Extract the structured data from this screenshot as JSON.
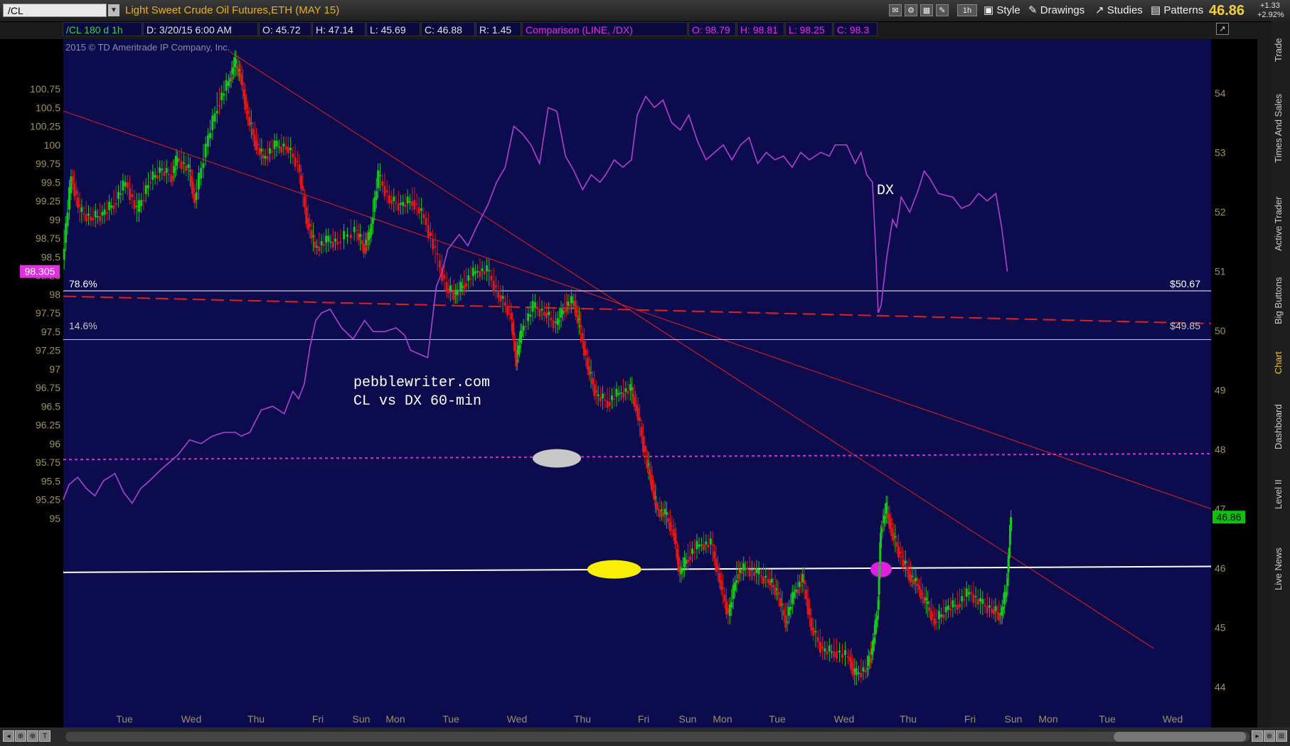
{
  "toolbar": {
    "symbol": "/CL",
    "instrument": "Light Sweet Crude Oil Futures,ETH (MAY 15)",
    "timeframe": "1h",
    "style_label": "Style",
    "drawings_label": "Drawings",
    "studies_label": "Studies",
    "patterns_label": "Patterns",
    "last_price": "46.86",
    "change_abs": "+1.33",
    "change_pct": "+2.92%"
  },
  "infobar": {
    "symbol_period": "/CL 180 d 1h",
    "date": "D: 3/20/15 6:00 AM",
    "open": "O: 45.72",
    "high": "H: 47.14",
    "low": "L: 45.69",
    "close": "C: 46.88",
    "range": "R: 1.45",
    "comparison": "Comparison (LINE, /DX)",
    "cmp_open": "O: 98.79",
    "cmp_high": "H: 98.81",
    "cmp_low": "L: 98.25",
    "cmp_close": "C: 98.3"
  },
  "side_tabs": [
    "Trade",
    "Times And Sales",
    "Active Trader",
    "Big Buttons",
    "Chart",
    "Dashboard",
    "Level II",
    "Live News"
  ],
  "colors": {
    "background": "#0c0b4e",
    "candle_up": "#18c818",
    "candle_down": "#e01818",
    "dx_line": "#b040d0",
    "trendline": "#e02020",
    "dotted_level": "#d030d0",
    "axis_text": "#a09060",
    "title_orange": "#e8b020"
  },
  "chart_data": {
    "type": "candlestick-with-comparison-line",
    "copyright": "2015 © TD Ameritrade IP Company, Inc.",
    "annotations": {
      "site": "pebblewriter.com",
      "subtitle": "CL vs DX 60-min",
      "dx_label": "DX",
      "fib_upper_pct": "78.6%",
      "fib_upper_price": "$50.67",
      "fib_lower_pct": "14.6%",
      "fib_lower_price": "$49.85"
    },
    "left_axis": {
      "label_series": "/DX",
      "range": [
        95.0,
        101.0
      ],
      "ticks": [
        "100.75",
        "100.5",
        "100.25",
        "100",
        "99.75",
        "99.5",
        "99.25",
        "99",
        "98.75",
        "98.5",
        "98.25",
        "98",
        "97.75",
        "97.5",
        "97.25",
        "97",
        "96.75",
        "96.5",
        "96.25",
        "96",
        "95.75",
        "95.5",
        "95.25",
        "95"
      ],
      "marker": "98.305"
    },
    "right_axis": {
      "label_series": "/CL",
      "range": [
        43.7,
        54.9
      ],
      "ticks": [
        "54",
        "53",
        "52",
        "51",
        "50",
        "49",
        "48",
        "47",
        "46",
        "45",
        "44"
      ],
      "marker": "46.86"
    },
    "x_labels": [
      "Tue",
      "Wed",
      "Thu",
      "Fri",
      "Sun",
      "Mon",
      "Tue",
      "Wed",
      "Thu",
      "Fri",
      "Sun",
      "Mon",
      "Tue",
      "Wed",
      "Thu",
      "Fri",
      "Sun",
      "Mon",
      "Tue",
      "Wed"
    ],
    "x_label_days": [
      1,
      2,
      3,
      4,
      5,
      6,
      7,
      8,
      9,
      10,
      11,
      12,
      13,
      14,
      15,
      16,
      17,
      18,
      19,
      20
    ],
    "x_range": [
      0.1,
      20.1
    ],
    "cl_series": [
      {
        "x": 0.1,
        "y": 51.2
      },
      {
        "x": 0.25,
        "y": 52.6
      },
      {
        "x": 0.4,
        "y": 52.0
      },
      {
        "x": 0.6,
        "y": 51.9
      },
      {
        "x": 0.8,
        "y": 51.95
      },
      {
        "x": 1.0,
        "y": 52.15
      },
      {
        "x": 1.2,
        "y": 52.5
      },
      {
        "x": 1.4,
        "y": 52.0
      },
      {
        "x": 1.6,
        "y": 52.5
      },
      {
        "x": 1.8,
        "y": 52.7
      },
      {
        "x": 2.0,
        "y": 52.6
      },
      {
        "x": 2.1,
        "y": 52.9
      },
      {
        "x": 2.3,
        "y": 52.7
      },
      {
        "x": 2.4,
        "y": 52.2
      },
      {
        "x": 2.6,
        "y": 53.1
      },
      {
        "x": 2.8,
        "y": 53.8
      },
      {
        "x": 3.0,
        "y": 54.2
      },
      {
        "x": 3.1,
        "y": 54.5
      },
      {
        "x": 3.2,
        "y": 54.3
      },
      {
        "x": 3.3,
        "y": 53.7
      },
      {
        "x": 3.45,
        "y": 53.2
      },
      {
        "x": 3.6,
        "y": 52.9
      },
      {
        "x": 3.8,
        "y": 53.1
      },
      {
        "x": 4.0,
        "y": 53.1
      },
      {
        "x": 4.2,
        "y": 52.8
      },
      {
        "x": 4.35,
        "y": 51.9
      },
      {
        "x": 4.5,
        "y": 51.4
      },
      {
        "x": 4.7,
        "y": 51.5
      },
      {
        "x": 4.9,
        "y": 51.5
      },
      {
        "x": 5.2,
        "y": 51.7
      },
      {
        "x": 5.35,
        "y": 51.4
      },
      {
        "x": 5.45,
        "y": 51.6
      },
      {
        "x": 5.6,
        "y": 52.6
      },
      {
        "x": 5.8,
        "y": 52.2
      },
      {
        "x": 6.0,
        "y": 52.1
      },
      {
        "x": 6.2,
        "y": 52.2
      },
      {
        "x": 6.4,
        "y": 51.9
      },
      {
        "x": 6.6,
        "y": 51.3
      },
      {
        "x": 6.8,
        "y": 50.7
      },
      {
        "x": 6.95,
        "y": 50.6
      },
      {
        "x": 7.1,
        "y": 50.8
      },
      {
        "x": 7.3,
        "y": 51.0
      },
      {
        "x": 7.5,
        "y": 51.0
      },
      {
        "x": 7.7,
        "y": 50.6
      },
      {
        "x": 7.9,
        "y": 50.3
      },
      {
        "x": 8.0,
        "y": 49.5
      },
      {
        "x": 8.1,
        "y": 50.0
      },
      {
        "x": 8.3,
        "y": 50.4
      },
      {
        "x": 8.5,
        "y": 50.3
      },
      {
        "x": 8.7,
        "y": 50.1
      },
      {
        "x": 8.85,
        "y": 50.4
      },
      {
        "x": 9.0,
        "y": 50.5
      },
      {
        "x": 9.1,
        "y": 50.1
      },
      {
        "x": 9.25,
        "y": 49.4
      },
      {
        "x": 9.4,
        "y": 48.9
      },
      {
        "x": 9.6,
        "y": 48.8
      },
      {
        "x": 9.8,
        "y": 48.95
      },
      {
        "x": 10.0,
        "y": 49.0
      },
      {
        "x": 10.1,
        "y": 48.7
      },
      {
        "x": 10.25,
        "y": 47.9
      },
      {
        "x": 10.35,
        "y": 47.5
      },
      {
        "x": 10.45,
        "y": 47.0
      },
      {
        "x": 10.6,
        "y": 46.9
      },
      {
        "x": 10.75,
        "y": 46.6
      },
      {
        "x": 10.85,
        "y": 45.9
      },
      {
        "x": 11.0,
        "y": 46.2
      },
      {
        "x": 11.2,
        "y": 46.4
      },
      {
        "x": 11.4,
        "y": 46.4
      },
      {
        "x": 11.55,
        "y": 45.8
      },
      {
        "x": 11.7,
        "y": 45.2
      },
      {
        "x": 11.85,
        "y": 45.9
      },
      {
        "x": 12.0,
        "y": 46.0
      },
      {
        "x": 12.2,
        "y": 45.9
      },
      {
        "x": 12.4,
        "y": 45.8
      },
      {
        "x": 12.55,
        "y": 45.6
      },
      {
        "x": 12.7,
        "y": 45.1
      },
      {
        "x": 12.85,
        "y": 45.6
      },
      {
        "x": 13.0,
        "y": 45.8
      },
      {
        "x": 13.15,
        "y": 45.0
      },
      {
        "x": 13.35,
        "y": 44.6
      },
      {
        "x": 13.55,
        "y": 44.6
      },
      {
        "x": 13.8,
        "y": 44.5
      },
      {
        "x": 13.9,
        "y": 44.2
      },
      {
        "x": 14.1,
        "y": 44.3
      },
      {
        "x": 14.2,
        "y": 44.6
      },
      {
        "x": 14.3,
        "y": 45.3
      },
      {
        "x": 14.35,
        "y": 46.6
      },
      {
        "x": 14.45,
        "y": 47.0
      },
      {
        "x": 14.55,
        "y": 46.6
      },
      {
        "x": 14.7,
        "y": 46.2
      },
      {
        "x": 14.85,
        "y": 45.9
      },
      {
        "x": 15.0,
        "y": 45.7
      },
      {
        "x": 15.15,
        "y": 45.4
      },
      {
        "x": 15.3,
        "y": 45.1
      },
      {
        "x": 15.5,
        "y": 45.3
      },
      {
        "x": 15.7,
        "y": 45.4
      },
      {
        "x": 15.9,
        "y": 45.6
      },
      {
        "x": 16.1,
        "y": 45.4
      },
      {
        "x": 16.3,
        "y": 45.3
      },
      {
        "x": 16.45,
        "y": 45.2
      },
      {
        "x": 16.55,
        "y": 45.7
      },
      {
        "x": 16.62,
        "y": 46.86
      }
    ],
    "dx_series": [
      {
        "x": 0.1,
        "y": 95.25
      },
      {
        "x": 0.2,
        "y": 95.45
      },
      {
        "x": 0.35,
        "y": 95.55
      },
      {
        "x": 0.5,
        "y": 95.4
      },
      {
        "x": 0.65,
        "y": 95.3
      },
      {
        "x": 0.8,
        "y": 95.5
      },
      {
        "x": 1.0,
        "y": 95.6
      },
      {
        "x": 1.15,
        "y": 95.35
      },
      {
        "x": 1.3,
        "y": 95.2
      },
      {
        "x": 1.45,
        "y": 95.4
      },
      {
        "x": 1.6,
        "y": 95.5
      },
      {
        "x": 1.8,
        "y": 95.65
      },
      {
        "x": 1.95,
        "y": 95.75
      },
      {
        "x": 2.1,
        "y": 95.85
      },
      {
        "x": 2.3,
        "y": 96.05
      },
      {
        "x": 2.5,
        "y": 96.0
      },
      {
        "x": 2.7,
        "y": 96.1
      },
      {
        "x": 2.9,
        "y": 96.15
      },
      {
        "x": 3.1,
        "y": 96.15
      },
      {
        "x": 3.2,
        "y": 96.1
      },
      {
        "x": 3.35,
        "y": 96.15
      },
      {
        "x": 3.55,
        "y": 96.45
      },
      {
        "x": 3.75,
        "y": 96.5
      },
      {
        "x": 3.95,
        "y": 96.4
      },
      {
        "x": 4.1,
        "y": 96.7
      },
      {
        "x": 4.2,
        "y": 96.6
      },
      {
        "x": 4.3,
        "y": 96.8
      },
      {
        "x": 4.4,
        "y": 97.3
      },
      {
        "x": 4.5,
        "y": 97.65
      },
      {
        "x": 4.6,
        "y": 97.75
      },
      {
        "x": 4.75,
        "y": 97.8
      },
      {
        "x": 4.95,
        "y": 97.55
      },
      {
        "x": 5.15,
        "y": 97.4
      },
      {
        "x": 5.35,
        "y": 97.65
      },
      {
        "x": 5.5,
        "y": 97.5
      },
      {
        "x": 5.7,
        "y": 97.5
      },
      {
        "x": 5.9,
        "y": 97.55
      },
      {
        "x": 6.05,
        "y": 97.45
      },
      {
        "x": 6.15,
        "y": 97.25
      },
      {
        "x": 6.3,
        "y": 97.2
      },
      {
        "x": 6.45,
        "y": 97.15
      },
      {
        "x": 6.6,
        "y": 98.1
      },
      {
        "x": 6.7,
        "y": 98.3
      },
      {
        "x": 6.8,
        "y": 98.6
      },
      {
        "x": 7.0,
        "y": 98.8
      },
      {
        "x": 7.15,
        "y": 98.65
      },
      {
        "x": 7.3,
        "y": 98.9
      },
      {
        "x": 7.5,
        "y": 99.2
      },
      {
        "x": 7.65,
        "y": 99.5
      },
      {
        "x": 7.8,
        "y": 99.7
      },
      {
        "x": 7.95,
        "y": 100.25
      },
      {
        "x": 8.1,
        "y": 100.15
      },
      {
        "x": 8.25,
        "y": 100.0
      },
      {
        "x": 8.4,
        "y": 99.75
      },
      {
        "x": 8.55,
        "y": 100.5
      },
      {
        "x": 8.7,
        "y": 100.45
      },
      {
        "x": 8.85,
        "y": 99.85
      },
      {
        "x": 9.0,
        "y": 99.65
      },
      {
        "x": 9.15,
        "y": 99.4
      },
      {
        "x": 9.3,
        "y": 99.6
      },
      {
        "x": 9.45,
        "y": 99.5
      },
      {
        "x": 9.55,
        "y": 99.6
      },
      {
        "x": 9.7,
        "y": 99.8
      },
      {
        "x": 9.85,
        "y": 99.7
      },
      {
        "x": 10.0,
        "y": 99.8
      },
      {
        "x": 10.1,
        "y": 100.4
      },
      {
        "x": 10.25,
        "y": 100.65
      },
      {
        "x": 10.4,
        "y": 100.5
      },
      {
        "x": 10.55,
        "y": 100.6
      },
      {
        "x": 10.7,
        "y": 100.3
      },
      {
        "x": 10.85,
        "y": 100.2
      },
      {
        "x": 11.0,
        "y": 100.4
      },
      {
        "x": 11.15,
        "y": 100.05
      },
      {
        "x": 11.3,
        "y": 99.8
      },
      {
        "x": 11.45,
        "y": 99.9
      },
      {
        "x": 11.6,
        "y": 100.0
      },
      {
        "x": 11.75,
        "y": 99.8
      },
      {
        "x": 11.9,
        "y": 100.0
      },
      {
        "x": 12.05,
        "y": 100.1
      },
      {
        "x": 12.2,
        "y": 99.75
      },
      {
        "x": 12.35,
        "y": 99.9
      },
      {
        "x": 12.5,
        "y": 99.8
      },
      {
        "x": 12.65,
        "y": 99.85
      },
      {
        "x": 12.8,
        "y": 99.7
      },
      {
        "x": 12.95,
        "y": 99.9
      },
      {
        "x": 13.1,
        "y": 99.8
      },
      {
        "x": 13.3,
        "y": 99.9
      },
      {
        "x": 13.45,
        "y": 99.85
      },
      {
        "x": 13.55,
        "y": 100.0
      },
      {
        "x": 13.75,
        "y": 100.0
      },
      {
        "x": 13.9,
        "y": 99.75
      },
      {
        "x": 14.0,
        "y": 99.9
      },
      {
        "x": 14.1,
        "y": 99.6
      },
      {
        "x": 14.2,
        "y": 99.5
      },
      {
        "x": 14.25,
        "y": 98.7
      },
      {
        "x": 14.3,
        "y": 97.75
      },
      {
        "x": 14.35,
        "y": 97.85
      },
      {
        "x": 14.45,
        "y": 98.5
      },
      {
        "x": 14.55,
        "y": 99.0
      },
      {
        "x": 14.62,
        "y": 98.9
      },
      {
        "x": 14.7,
        "y": 99.3
      },
      {
        "x": 14.85,
        "y": 99.1
      },
      {
        "x": 15.0,
        "y": 99.4
      },
      {
        "x": 15.1,
        "y": 99.65
      },
      {
        "x": 15.2,
        "y": 99.55
      },
      {
        "x": 15.35,
        "y": 99.35
      },
      {
        "x": 15.6,
        "y": 99.3
      },
      {
        "x": 15.75,
        "y": 99.15
      },
      {
        "x": 15.9,
        "y": 99.2
      },
      {
        "x": 16.05,
        "y": 99.35
      },
      {
        "x": 16.2,
        "y": 99.25
      },
      {
        "x": 16.35,
        "y": 99.35
      },
      {
        "x": 16.45,
        "y": 98.9
      },
      {
        "x": 16.55,
        "y": 98.305
      }
    ],
    "overlays": [
      {
        "kind": "trend",
        "from": {
          "x": 0.1,
          "y": 53.7
        },
        "to": {
          "x": 20.1,
          "y": 47.0
        },
        "color": "#e02020",
        "width": 1
      },
      {
        "kind": "trend",
        "from": {
          "x": 3.0,
          "y": 54.7
        },
        "to": {
          "x": 19.1,
          "y": 44.65
        },
        "color": "#e02020",
        "width": 1
      },
      {
        "kind": "dashed",
        "from": {
          "x": 0.1,
          "y": 50.58
        },
        "to": {
          "x": 20.1,
          "y": 50.12
        },
        "color": "#e02020",
        "width": 2
      },
      {
        "kind": "dotted",
        "from": {
          "x": 0.1,
          "y": 47.83
        },
        "to": {
          "x": 20.1,
          "y": 47.93
        },
        "color": "#d030d0",
        "width": 2
      },
      {
        "kind": "solid",
        "from": {
          "x": 0.1,
          "y": 45.93
        },
        "to": {
          "x": 20.1,
          "y": 46.03
        },
        "color": "#ffffff",
        "width": 2
      },
      {
        "kind": "fib",
        "y": 50.67,
        "color": "#ffffff",
        "width": 1
      },
      {
        "kind": "fib",
        "y": 49.85,
        "color": "#c8c8c8",
        "width": 1
      }
    ],
    "markers": [
      {
        "x": 8.7,
        "y": 47.85,
        "color": "#c8c8c8"
      },
      {
        "x": 9.7,
        "y": 45.98,
        "color": "#f8f000"
      },
      {
        "x": 14.35,
        "y": 45.98,
        "color": "#e020e0"
      }
    ],
    "grid": false
  }
}
